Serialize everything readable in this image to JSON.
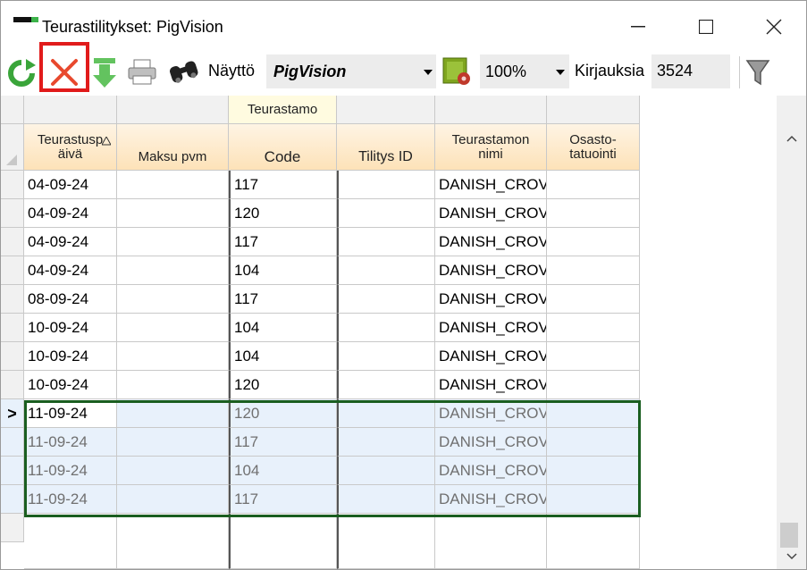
{
  "window": {
    "title": "Teurastilitykset: PigVision",
    "minimize_glyph": "—",
    "maximize_glyph": "☐",
    "close_glyph": "✕"
  },
  "toolbar": {
    "nayto_label": "Näyttö",
    "view_value": "PigVision",
    "zoom_value": "100%",
    "records_label": "Kirjauksia",
    "records_count": "3524",
    "icons": [
      "refresh-icon",
      "delete-icon",
      "download-icon",
      "print-icon",
      "binoculars-icon",
      "report-settings-icon",
      "filter-icon"
    ]
  },
  "grid": {
    "group_header": "Teurastamo",
    "columns": [
      {
        "label": "Teurastusp äivä"
      },
      {
        "label": "Maksu pvm"
      },
      {
        "label": "Code"
      },
      {
        "label": "Tilitys ID"
      },
      {
        "label": "Teurastamon nimi"
      },
      {
        "label": "Osasto-tatuointi"
      }
    ],
    "rows": [
      {
        "date": "04-09-24",
        "pay": "",
        "code": "117",
        "tid": "",
        "name": "DANISH_CROV",
        "dept": ""
      },
      {
        "date": "04-09-24",
        "pay": "",
        "code": "120",
        "tid": "",
        "name": "DANISH_CROV",
        "dept": ""
      },
      {
        "date": "04-09-24",
        "pay": "",
        "code": "117",
        "tid": "",
        "name": "DANISH_CROV",
        "dept": ""
      },
      {
        "date": "04-09-24",
        "pay": "",
        "code": "104",
        "tid": "",
        "name": "DANISH_CROV",
        "dept": ""
      },
      {
        "date": "08-09-24",
        "pay": "",
        "code": "117",
        "tid": "",
        "name": "DANISH_CROV",
        "dept": ""
      },
      {
        "date": "10-09-24",
        "pay": "",
        "code": "104",
        "tid": "",
        "name": "DANISH_CROV",
        "dept": ""
      },
      {
        "date": "10-09-24",
        "pay": "",
        "code": "104",
        "tid": "",
        "name": "DANISH_CROV",
        "dept": ""
      },
      {
        "date": "10-09-24",
        "pay": "",
        "code": "120",
        "tid": "",
        "name": "DANISH_CROV",
        "dept": ""
      },
      {
        "date": "11-09-24",
        "pay": "",
        "code": "120",
        "tid": "",
        "name": "DANISH_CROV",
        "dept": "",
        "current": true
      },
      {
        "date": "11-09-24",
        "pay": "",
        "code": "117",
        "tid": "",
        "name": "DANISH_CROV",
        "dept": ""
      },
      {
        "date": "11-09-24",
        "pay": "",
        "code": "104",
        "tid": "",
        "name": "DANISH_CROV",
        "dept": ""
      },
      {
        "date": "11-09-24",
        "pay": "",
        "code": "117",
        "tid": "",
        "name": "DANISH_CROV",
        "dept": ""
      }
    ],
    "current_row_marker": ">"
  },
  "colors": {
    "header_bg": "#fde2b8",
    "selection_border": "#1a5e20",
    "selection_bg": "#e8f1fb",
    "delete_highlight": "#e11b1b"
  }
}
